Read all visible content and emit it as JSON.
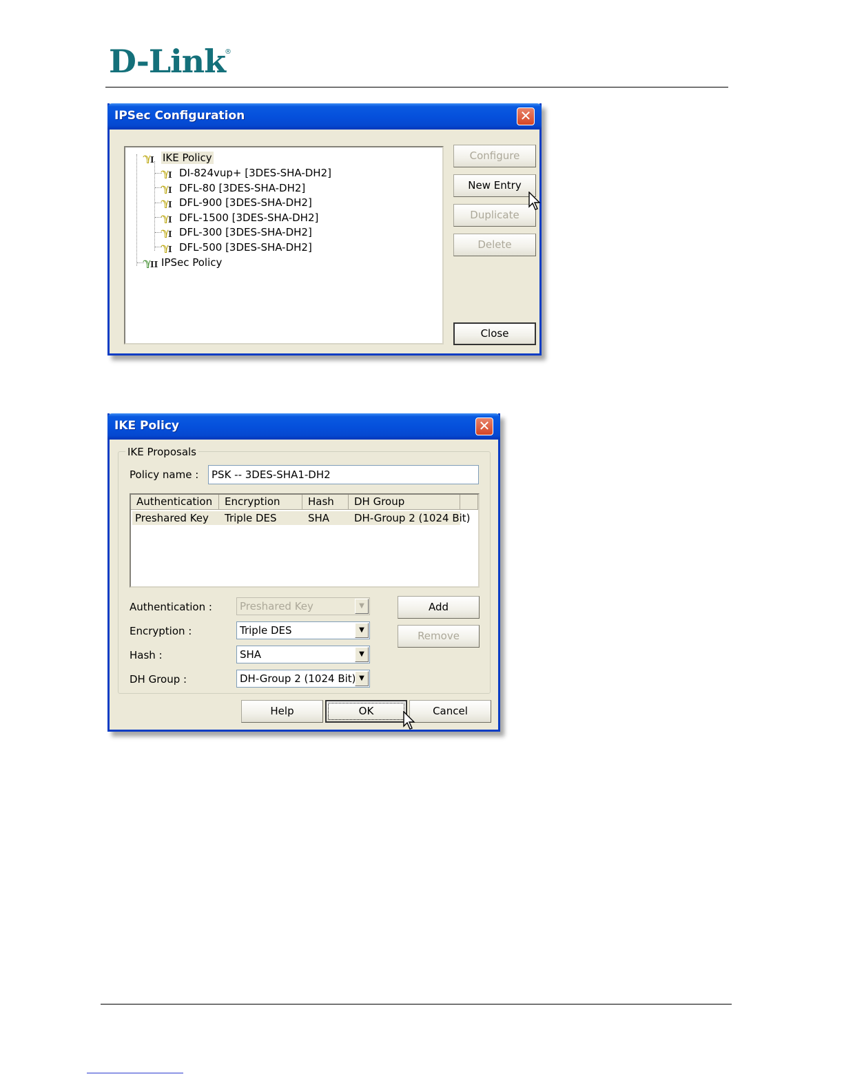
{
  "brand": {
    "logo_text": "D-Link",
    "registered": "®"
  },
  "ipsec_window": {
    "title": "IPSec Configuration",
    "close_glyph": "✕",
    "tree": {
      "root": "IKE Policy",
      "children": [
        "DI-824vup+ [3DES-SHA-DH2]",
        "DFL-80 [3DES-SHA-DH2]",
        "DFL-900 [3DES-SHA-DH2]",
        "DFL-1500 [3DES-SHA-DH2]",
        "DFL-300 [3DES-SHA-DH2]",
        "DFL-500 [3DES-SHA-DH2]"
      ],
      "second_root": "IPSec Policy",
      "ike_badge": "I",
      "ipsec_badge": "II"
    },
    "buttons": {
      "configure": "Configure",
      "new_entry": "New Entry",
      "duplicate": "Duplicate",
      "delete": "Delete",
      "close": "Close"
    }
  },
  "ike_window": {
    "title": "IKE Policy",
    "close_glyph": "✕",
    "group_label": "IKE Proposals",
    "policy_name_label": "Policy name :",
    "policy_name_value": "PSK -- 3DES-SHA1-DH2",
    "columns": [
      "Authentication",
      "Encryption",
      "Hash",
      "DH Group"
    ],
    "rows": [
      [
        "Preshared Key",
        "Triple DES",
        "SHA",
        "DH-Group 2 (1024 Bit)"
      ]
    ],
    "fields": {
      "authentication_label": "Authentication :",
      "authentication_value": "Preshared Key",
      "encryption_label": "Encryption :",
      "encryption_value": "Triple DES",
      "hash_label": "Hash :",
      "hash_value": "SHA",
      "dh_group_label": "DH Group :",
      "dh_group_value": "DH-Group 2 (1024 Bit)"
    },
    "buttons": {
      "add": "Add",
      "remove": "Remove",
      "help": "Help",
      "ok": "OK",
      "cancel": "Cancel"
    }
  },
  "colors": {
    "brand": "#14707a",
    "titlebar": "#0550dc",
    "window_bg": "#ece9d8",
    "close_button": "#d44626"
  },
  "icons": [
    "key-policy-icon",
    "close-icon",
    "dropdown-arrow-icon",
    "mouse-cursor-icon"
  ]
}
